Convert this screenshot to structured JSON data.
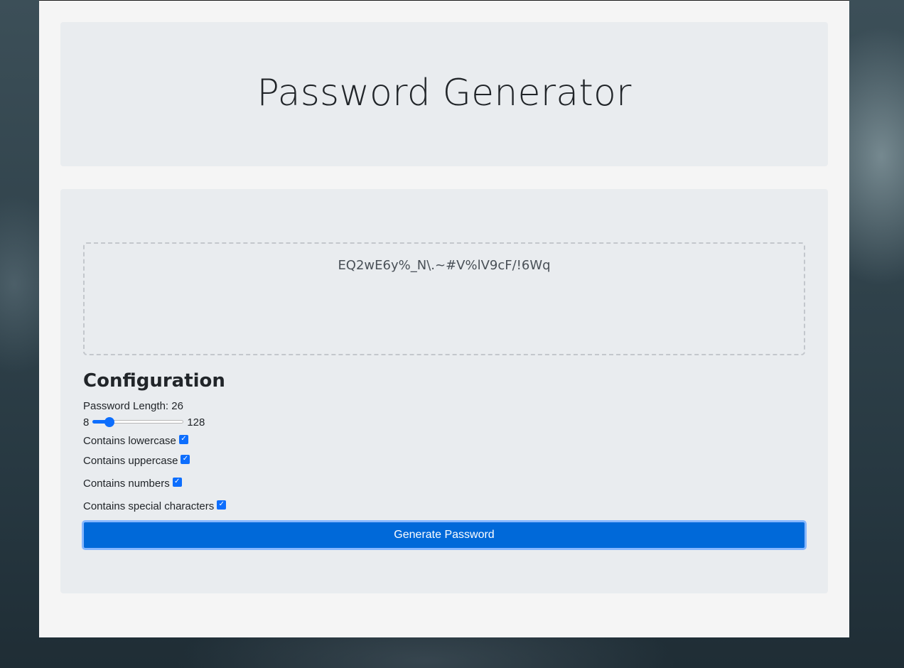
{
  "app": {
    "title": "Password Generator"
  },
  "password": {
    "value": "EQ2wE6y%_N\\.~#V%lV9cF/!6Wq"
  },
  "configuration": {
    "heading": "Configuration",
    "length_label": "Password Length: 26",
    "length_value": 26,
    "slider": {
      "min_label": "8",
      "max_label": "128",
      "min": 8,
      "max": 128,
      "value": 26
    },
    "options": [
      {
        "label": "Contains lowercase",
        "checked": true
      },
      {
        "label": "Contains uppercase",
        "checked": true
      },
      {
        "label": "Contains numbers",
        "checked": true
      },
      {
        "label": "Contains special characters",
        "checked": true
      }
    ]
  },
  "actions": {
    "generate_label": "Generate Password"
  },
  "colors": {
    "accent": "#0d6efd",
    "button": "#0069d9",
    "card_bg": "#e9ecef",
    "page_bg": "#f5f5f5"
  },
  "icons": {
    "checkbox": "checkmark-icon"
  }
}
